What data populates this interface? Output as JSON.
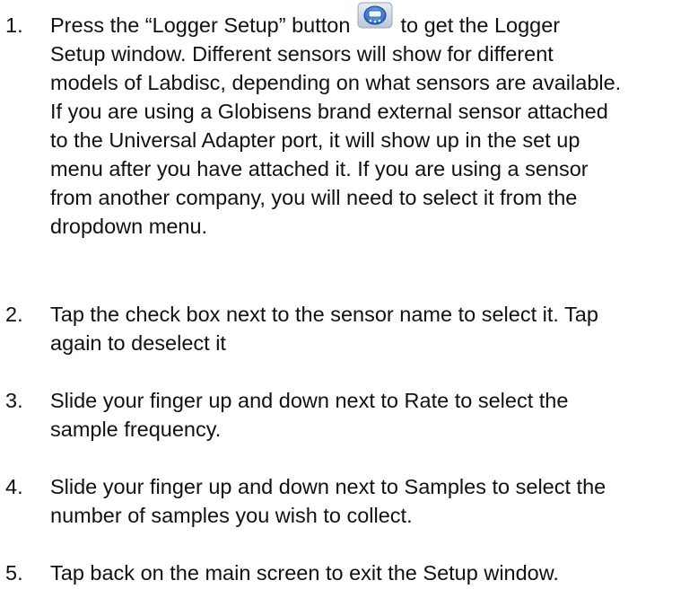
{
  "document": {
    "steps": [
      {
        "number": "1.",
        "lines": [
          "Press the “Logger Setup” button",
          "to get the Logger",
          "Setup window.  Different sensors will show for different",
          "models of Labdisc, depending on what sensors are available.",
          "If you are using a Globisens brand external sensor attached",
          "to the Universal Adapter port, it will show up in the set up",
          "menu after you have attached it.  If you are using a sensor",
          "from another company, you will need to select it from the",
          "dropdown menu."
        ],
        "icon": "logger-setup-icon"
      },
      {
        "number": "2.",
        "lines": [
          "Tap the check box next to the sensor name to select it.  Tap",
          "again to deselect it"
        ]
      },
      {
        "number": "3.",
        "lines": [
          "Slide your finger up and down next to Rate to select the",
          "sample frequency."
        ]
      },
      {
        "number": "4.",
        "lines": [
          "Slide your finger up and down next to Samples to select the",
          "number of samples you wish to collect."
        ]
      },
      {
        "number": "5.",
        "lines": [
          "Tap back on the main screen to exit the Setup window."
        ]
      }
    ]
  },
  "colors": {
    "text": "#111111",
    "icon_blue": "#3d7fd6",
    "icon_border": "#9aa7b8"
  }
}
